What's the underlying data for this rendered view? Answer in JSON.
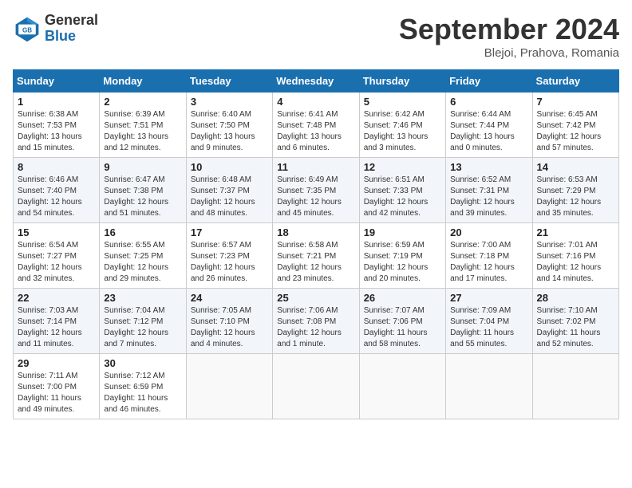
{
  "header": {
    "logo": {
      "general": "General",
      "blue": "Blue"
    },
    "title": "September 2024",
    "subtitle": "Blejoi, Prahova, Romania"
  },
  "weekdays": [
    "Sunday",
    "Monday",
    "Tuesday",
    "Wednesday",
    "Thursday",
    "Friday",
    "Saturday"
  ],
  "weeks": [
    [
      {
        "day": "1",
        "sunrise": "Sunrise: 6:38 AM",
        "sunset": "Sunset: 7:53 PM",
        "daylight": "Daylight: 13 hours and 15 minutes."
      },
      {
        "day": "2",
        "sunrise": "Sunrise: 6:39 AM",
        "sunset": "Sunset: 7:51 PM",
        "daylight": "Daylight: 13 hours and 12 minutes."
      },
      {
        "day": "3",
        "sunrise": "Sunrise: 6:40 AM",
        "sunset": "Sunset: 7:50 PM",
        "daylight": "Daylight: 13 hours and 9 minutes."
      },
      {
        "day": "4",
        "sunrise": "Sunrise: 6:41 AM",
        "sunset": "Sunset: 7:48 PM",
        "daylight": "Daylight: 13 hours and 6 minutes."
      },
      {
        "day": "5",
        "sunrise": "Sunrise: 6:42 AM",
        "sunset": "Sunset: 7:46 PM",
        "daylight": "Daylight: 13 hours and 3 minutes."
      },
      {
        "day": "6",
        "sunrise": "Sunrise: 6:44 AM",
        "sunset": "Sunset: 7:44 PM",
        "daylight": "Daylight: 13 hours and 0 minutes."
      },
      {
        "day": "7",
        "sunrise": "Sunrise: 6:45 AM",
        "sunset": "Sunset: 7:42 PM",
        "daylight": "Daylight: 12 hours and 57 minutes."
      }
    ],
    [
      {
        "day": "8",
        "sunrise": "Sunrise: 6:46 AM",
        "sunset": "Sunset: 7:40 PM",
        "daylight": "Daylight: 12 hours and 54 minutes."
      },
      {
        "day": "9",
        "sunrise": "Sunrise: 6:47 AM",
        "sunset": "Sunset: 7:38 PM",
        "daylight": "Daylight: 12 hours and 51 minutes."
      },
      {
        "day": "10",
        "sunrise": "Sunrise: 6:48 AM",
        "sunset": "Sunset: 7:37 PM",
        "daylight": "Daylight: 12 hours and 48 minutes."
      },
      {
        "day": "11",
        "sunrise": "Sunrise: 6:49 AM",
        "sunset": "Sunset: 7:35 PM",
        "daylight": "Daylight: 12 hours and 45 minutes."
      },
      {
        "day": "12",
        "sunrise": "Sunrise: 6:51 AM",
        "sunset": "Sunset: 7:33 PM",
        "daylight": "Daylight: 12 hours and 42 minutes."
      },
      {
        "day": "13",
        "sunrise": "Sunrise: 6:52 AM",
        "sunset": "Sunset: 7:31 PM",
        "daylight": "Daylight: 12 hours and 39 minutes."
      },
      {
        "day": "14",
        "sunrise": "Sunrise: 6:53 AM",
        "sunset": "Sunset: 7:29 PM",
        "daylight": "Daylight: 12 hours and 35 minutes."
      }
    ],
    [
      {
        "day": "15",
        "sunrise": "Sunrise: 6:54 AM",
        "sunset": "Sunset: 7:27 PM",
        "daylight": "Daylight: 12 hours and 32 minutes."
      },
      {
        "day": "16",
        "sunrise": "Sunrise: 6:55 AM",
        "sunset": "Sunset: 7:25 PM",
        "daylight": "Daylight: 12 hours and 29 minutes."
      },
      {
        "day": "17",
        "sunrise": "Sunrise: 6:57 AM",
        "sunset": "Sunset: 7:23 PM",
        "daylight": "Daylight: 12 hours and 26 minutes."
      },
      {
        "day": "18",
        "sunrise": "Sunrise: 6:58 AM",
        "sunset": "Sunset: 7:21 PM",
        "daylight": "Daylight: 12 hours and 23 minutes."
      },
      {
        "day": "19",
        "sunrise": "Sunrise: 6:59 AM",
        "sunset": "Sunset: 7:19 PM",
        "daylight": "Daylight: 12 hours and 20 minutes."
      },
      {
        "day": "20",
        "sunrise": "Sunrise: 7:00 AM",
        "sunset": "Sunset: 7:18 PM",
        "daylight": "Daylight: 12 hours and 17 minutes."
      },
      {
        "day": "21",
        "sunrise": "Sunrise: 7:01 AM",
        "sunset": "Sunset: 7:16 PM",
        "daylight": "Daylight: 12 hours and 14 minutes."
      }
    ],
    [
      {
        "day": "22",
        "sunrise": "Sunrise: 7:03 AM",
        "sunset": "Sunset: 7:14 PM",
        "daylight": "Daylight: 12 hours and 11 minutes."
      },
      {
        "day": "23",
        "sunrise": "Sunrise: 7:04 AM",
        "sunset": "Sunset: 7:12 PM",
        "daylight": "Daylight: 12 hours and 7 minutes."
      },
      {
        "day": "24",
        "sunrise": "Sunrise: 7:05 AM",
        "sunset": "Sunset: 7:10 PM",
        "daylight": "Daylight: 12 hours and 4 minutes."
      },
      {
        "day": "25",
        "sunrise": "Sunrise: 7:06 AM",
        "sunset": "Sunset: 7:08 PM",
        "daylight": "Daylight: 12 hours and 1 minute."
      },
      {
        "day": "26",
        "sunrise": "Sunrise: 7:07 AM",
        "sunset": "Sunset: 7:06 PM",
        "daylight": "Daylight: 11 hours and 58 minutes."
      },
      {
        "day": "27",
        "sunrise": "Sunrise: 7:09 AM",
        "sunset": "Sunset: 7:04 PM",
        "daylight": "Daylight: 11 hours and 55 minutes."
      },
      {
        "day": "28",
        "sunrise": "Sunrise: 7:10 AM",
        "sunset": "Sunset: 7:02 PM",
        "daylight": "Daylight: 11 hours and 52 minutes."
      }
    ],
    [
      {
        "day": "29",
        "sunrise": "Sunrise: 7:11 AM",
        "sunset": "Sunset: 7:00 PM",
        "daylight": "Daylight: 11 hours and 49 minutes."
      },
      {
        "day": "30",
        "sunrise": "Sunrise: 7:12 AM",
        "sunset": "Sunset: 6:59 PM",
        "daylight": "Daylight: 11 hours and 46 minutes."
      },
      null,
      null,
      null,
      null,
      null
    ]
  ]
}
